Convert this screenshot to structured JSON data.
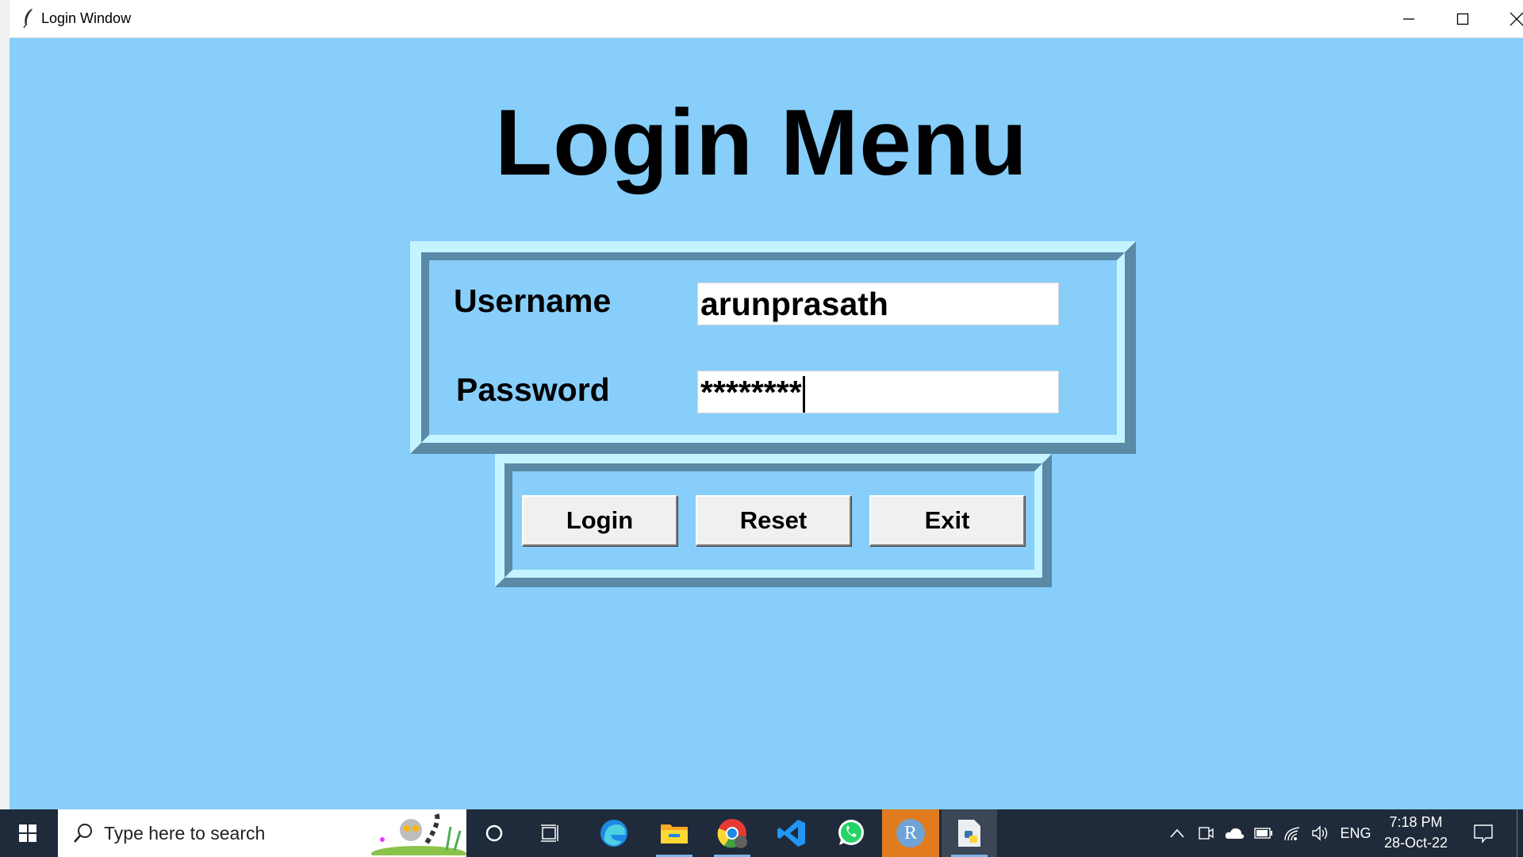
{
  "window": {
    "title": "Login Window"
  },
  "heading": "Login Menu",
  "form": {
    "username_label": "Username",
    "username_value": "arunprasath",
    "password_label": "Password",
    "password_value": "********"
  },
  "buttons": {
    "login": "Login",
    "reset": "Reset",
    "exit": "Exit"
  },
  "taskbar": {
    "search_placeholder": "Type here to search",
    "language": "ENG",
    "time": "7:18 PM",
    "date": "28-Oct-22",
    "r_app_letter": "R"
  },
  "colors": {
    "background": "#87cefa",
    "frame_light": "#c4f4ff",
    "frame_dark": "#5a8aa6",
    "taskbar": "#1f2b3a"
  }
}
